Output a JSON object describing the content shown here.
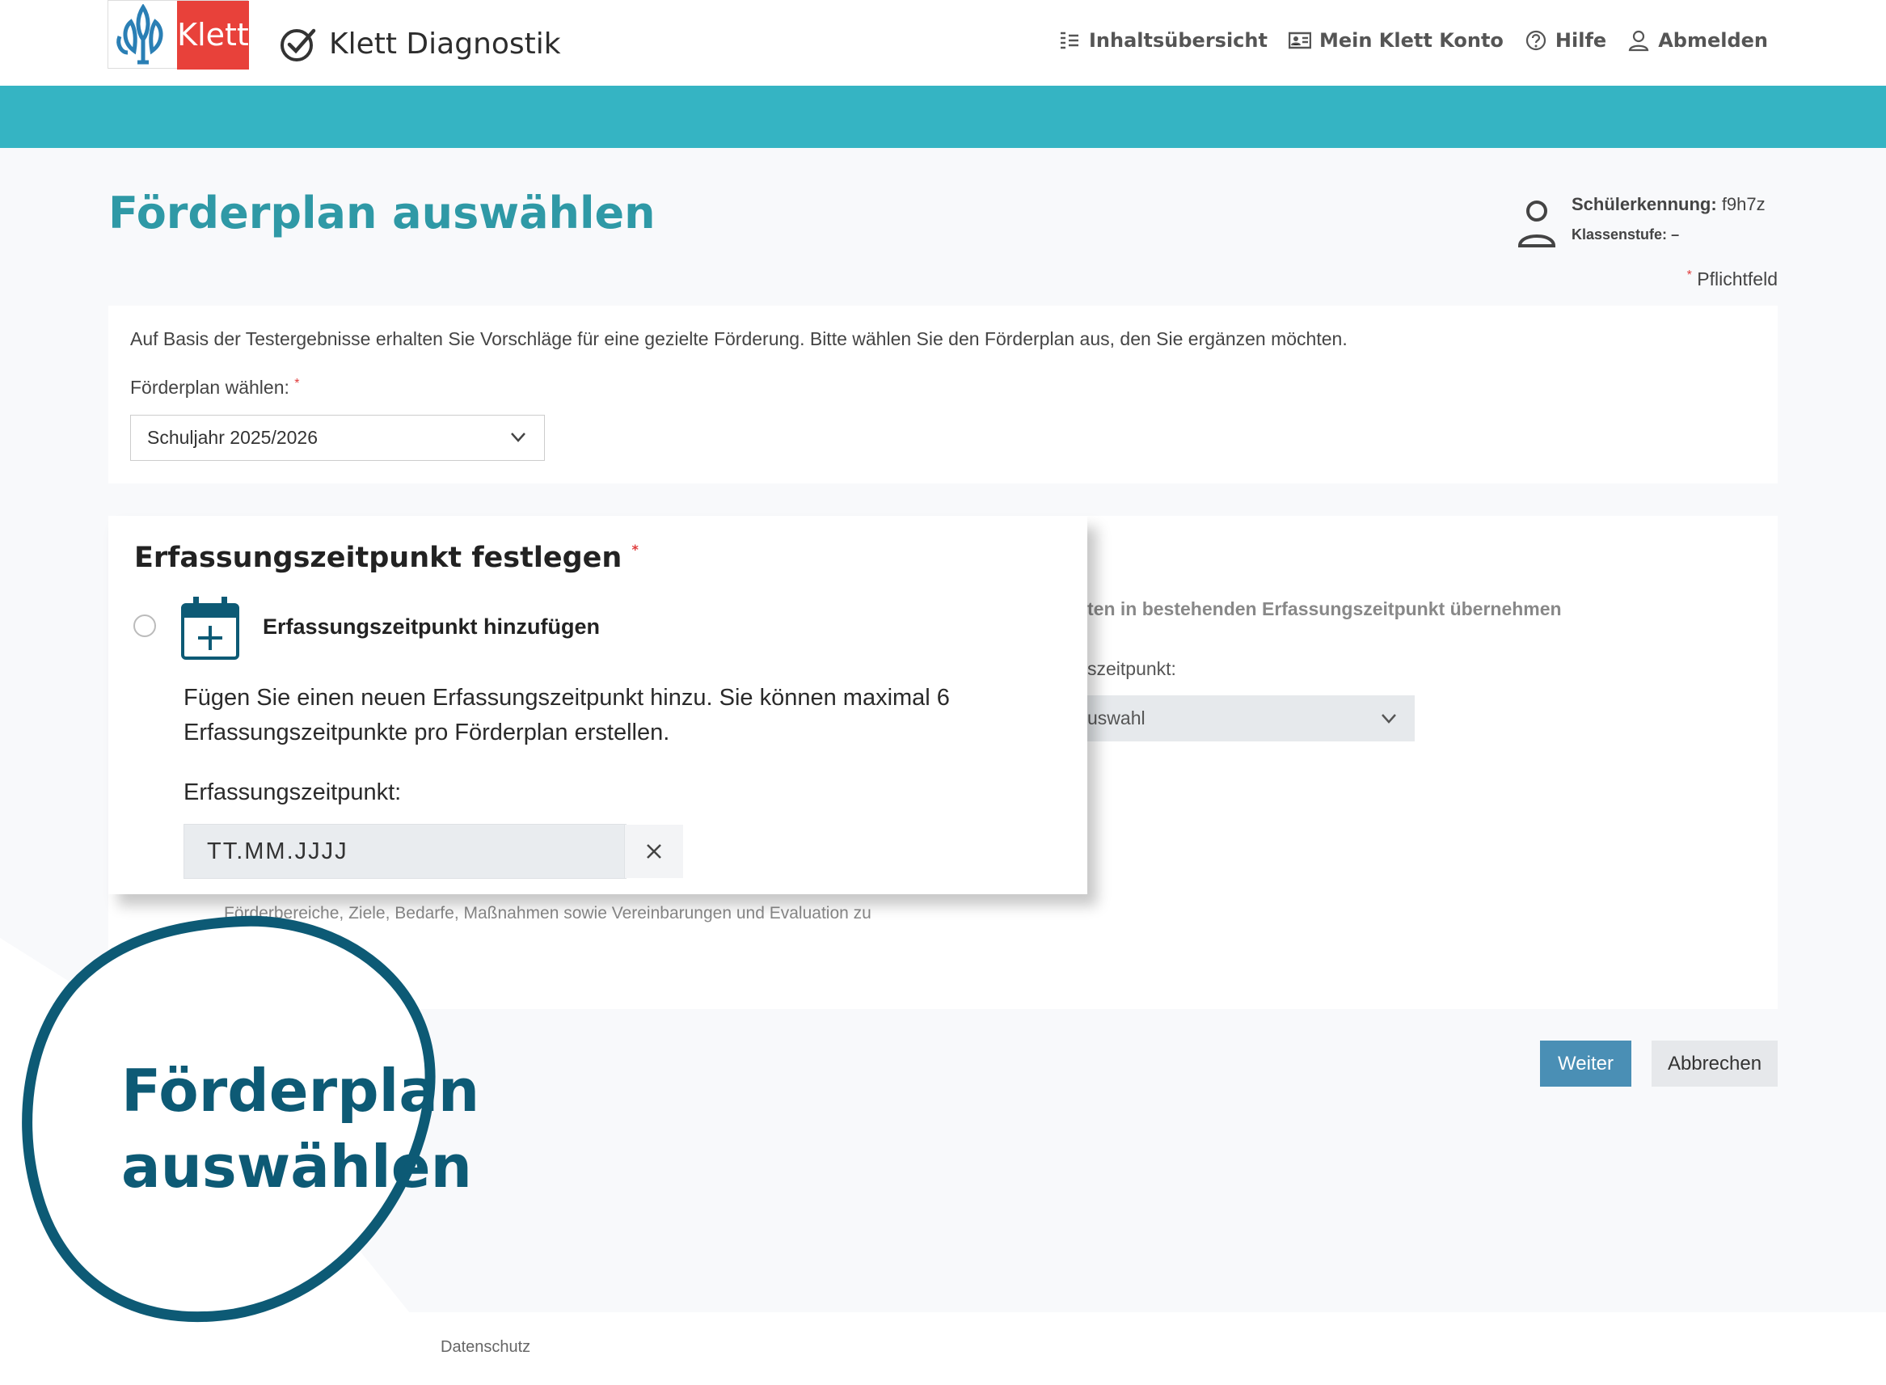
{
  "brand": {
    "logo_text": "Klett",
    "product_name": "Klett Diagnostik"
  },
  "nav": [
    {
      "label": "Inhaltsübersicht",
      "icon": "list-icon"
    },
    {
      "label": "Mein Klett Konto",
      "icon": "id-card-icon"
    },
    {
      "label": "Hilfe",
      "icon": "help-circle-icon"
    },
    {
      "label": "Abmelden",
      "icon": "user-icon"
    }
  ],
  "page": {
    "title": "Förderplan auswählen",
    "student_id_label": "Schülerkennung:",
    "student_id_value": "f9h7z",
    "grade_label": "Klassenstufe:",
    "grade_value": "–",
    "required_note": "Pflichtfeld"
  },
  "foerderplan": {
    "intro": "Auf Basis der Testergebnisse erhalten Sie Vorschläge für eine gezielte Förderung. Bitte wählen Sie den Förderplan aus, den Sie ergänzen möchten.",
    "label": "Förderplan wählen:",
    "selected": "Schuljahr 2025/2026"
  },
  "background_panel": {
    "title_fragment": "ten in bestehenden Erfassungszeitpunkt übernehmen",
    "label_fragment": "szeitpunkt:",
    "select_fragment": "uswahl",
    "desc_fragment": "Förderbereiche, Ziele, Bedarfe, Maßnahmen sowie Vereinbarungen und Evaluation zu"
  },
  "erfassung": {
    "title": "Erfassungszeitpunkt festlegen",
    "option_label": "Erfassungszeitpunkt hinzufügen",
    "option_desc": "Fügen Sie einen neuen Erfassungszeitpunkt hinzu. Sie können maximal 6 Erfassungszeitpunkte pro Förderplan erstellen.",
    "field_label": "Erfassungszeitpunkt:",
    "placeholder": "TT.MM.JJJJ"
  },
  "buttons": {
    "next": "Weiter",
    "cancel": "Abbrechen"
  },
  "footer": {
    "privacy_fragment": "Datenschutz"
  },
  "promo": {
    "line1": "Förderplan",
    "line2": "auswählen"
  },
  "colors": {
    "teal": "#35b4c3",
    "title": "#2f99a6",
    "navy": "#0d5a75",
    "button": "#4a8fb5",
    "red": "#e8413a"
  }
}
